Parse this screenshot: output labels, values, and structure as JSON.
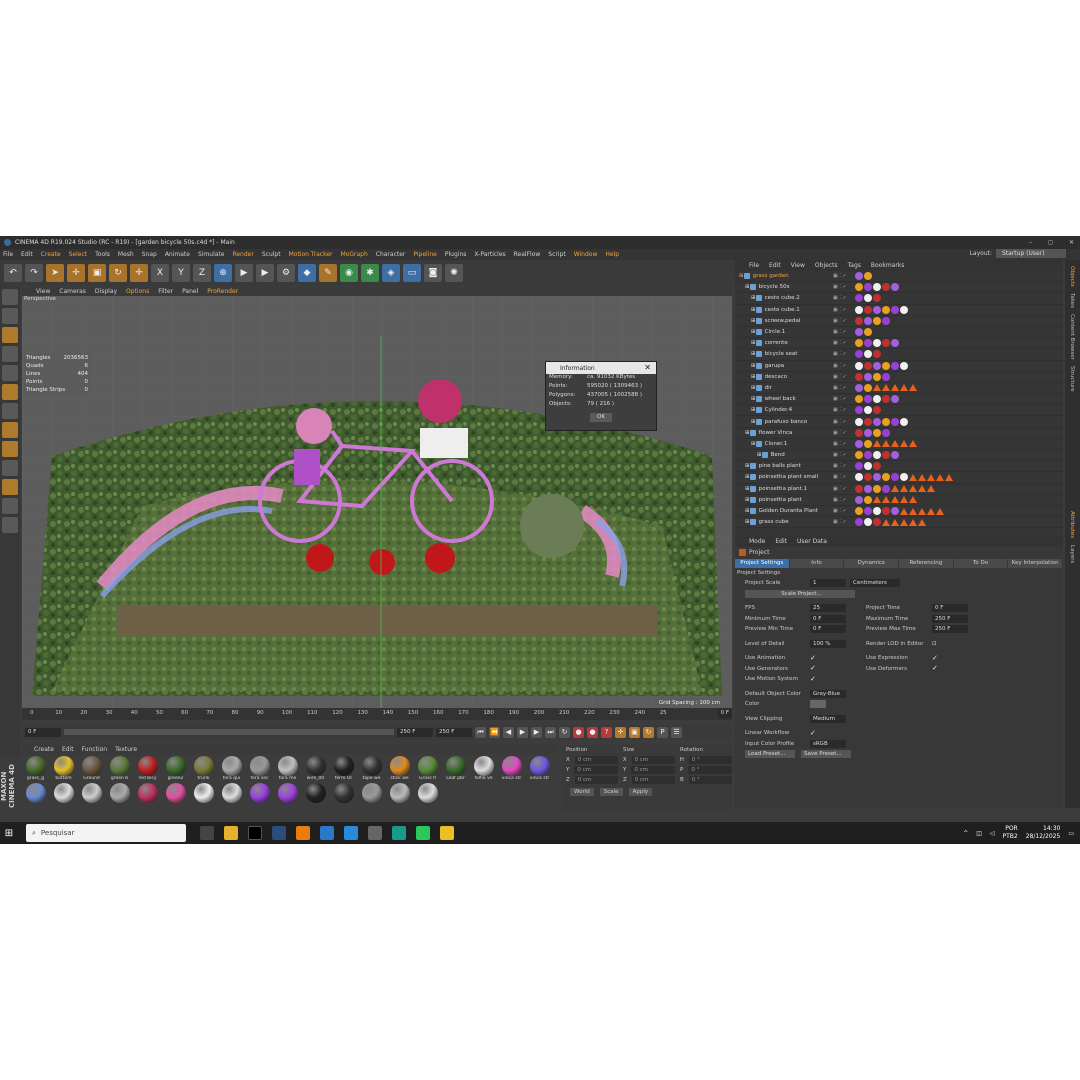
{
  "window": {
    "title": "CINEMA 4D R19.024 Studio (RC - R19) - [garden bicycle 50s.c4d *] - Main",
    "ctrl": [
      "–",
      "◻",
      "✕"
    ]
  },
  "menu": [
    "File",
    "Edit",
    "Create",
    "Select",
    "Tools",
    "Mesh",
    "Snap",
    "Animate",
    "Simulate",
    "Render",
    "Sculpt",
    "Motion Tracker",
    "MoGraph",
    "Character",
    "Pipeline",
    "Plugins",
    "X-Particles",
    "RealFlow",
    "Script",
    "Window",
    "Help"
  ],
  "menu_highlight": [
    "Create",
    "Select",
    "Render",
    "Motion Tracker",
    "MoGraph",
    "Pipeline",
    "Window",
    "Help"
  ],
  "layout": {
    "label": "Layout:",
    "value": "Startup (User)"
  },
  "viewport": {
    "menu": [
      "View",
      "Cameras",
      "Display",
      "Options",
      "Filter",
      "Panel",
      "ProRender"
    ],
    "label": "Perspective",
    "grid": "Grid Spacing : 100 cm"
  },
  "stats": [
    [
      "Triangles",
      "2036563"
    ],
    [
      "Quads",
      "6"
    ],
    [
      "Lines",
      "404"
    ],
    [
      "Points",
      "0"
    ],
    [
      "Triangle Strips",
      "0"
    ]
  ],
  "info_dialog": {
    "title": "Information",
    "rows": [
      [
        "Memory:",
        "ca. 91032 KBytes"
      ],
      [
        "Points:",
        "595020 ( 1309463 )"
      ],
      [
        "Polygons:",
        "437005 ( 1002588 )"
      ],
      [
        "Objects:",
        "79 ( 216 )"
      ]
    ],
    "ok": "OK"
  },
  "timeline": {
    "ticks": [
      "0",
      "10",
      "20",
      "30",
      "40",
      "50",
      "60",
      "70",
      "80",
      "90",
      "100",
      "110",
      "120",
      "130",
      "140",
      "150",
      "160",
      "170",
      "180",
      "190",
      "200",
      "210",
      "220",
      "230",
      "240",
      "25"
    ],
    "cur": "0 F",
    "start": "0 F",
    "end": "250 F",
    "end2": "250 F"
  },
  "materials": {
    "menu": [
      "Create",
      "Edit",
      "Function",
      "Texture"
    ],
    "items": [
      {
        "n": "grass_g",
        "c": "#4a6a2c"
      },
      {
        "n": "bottom",
        "c": "#e4c02a"
      },
      {
        "n": "Ground",
        "c": "#6a5a40"
      },
      {
        "n": "green b",
        "c": "#5a7a3a"
      },
      {
        "n": "red bicy",
        "c": "#c02020"
      },
      {
        "n": "green2",
        "c": "#3a6a2a"
      },
      {
        "n": "trunk",
        "c": "#7a7a3a"
      },
      {
        "n": "fora qui",
        "c": "#aaa"
      },
      {
        "n": "fora sec",
        "c": "#999"
      },
      {
        "n": "fora me",
        "c": "#c0c0c0"
      },
      {
        "n": "wire_00",
        "c": "#333"
      },
      {
        "n": "ferro Or",
        "c": "#222"
      },
      {
        "n": "tape we",
        "c": "#333"
      },
      {
        "n": "stick we",
        "c": "#e08a20"
      },
      {
        "n": "Grass fl",
        "c": "#5a8a3a"
      },
      {
        "n": "Leaf pbr",
        "c": "#3a6a2a"
      },
      {
        "n": "folha ve",
        "c": "#ddd"
      },
      {
        "n": "vinca str",
        "c": "#e04ac0"
      },
      {
        "n": "vinca str",
        "c": "#6a5ae0"
      },
      {
        "n": "",
        "c": "#6a8ad0"
      },
      {
        "n": "",
        "c": "#ddd"
      },
      {
        "n": "",
        "c": "#ccc"
      },
      {
        "n": "",
        "c": "#aaa"
      },
      {
        "n": "",
        "c": "#c03060"
      },
      {
        "n": "",
        "c": "#e050a0"
      },
      {
        "n": "",
        "c": "#eee"
      },
      {
        "n": "",
        "c": "#ddd"
      },
      {
        "n": "",
        "c": "#9a40e0"
      },
      {
        "n": "",
        "c": "#a040e0"
      },
      {
        "n": "",
        "c": "#222"
      },
      {
        "n": "",
        "c": "#333"
      },
      {
        "n": "",
        "c": "#999"
      },
      {
        "n": "",
        "c": "#bbb"
      },
      {
        "n": "",
        "c": "#ddd"
      }
    ]
  },
  "coords": {
    "rows": [
      [
        "X",
        "0 cm",
        "X",
        "0 cm",
        "H",
        "0 °"
      ],
      [
        "Y",
        "0 cm",
        "Y",
        "0 cm",
        "P",
        "0 °"
      ],
      [
        "Z",
        "0 cm",
        "Z",
        "0 cm",
        "B",
        "0 °"
      ]
    ],
    "world": "World",
    "scale": "Scale",
    "apply": "Apply",
    "head": [
      "Position",
      "Size",
      "Rotation"
    ]
  },
  "objects": {
    "menu": [
      "File",
      "Edit",
      "View",
      "Objects",
      "Tags",
      "Bookmarks"
    ],
    "rows": [
      {
        "n": "grass garden",
        "sel": true,
        "ind": 0
      },
      {
        "n": "bicycle 50s",
        "ind": 1
      },
      {
        "n": "cesto cube.2",
        "ind": 2
      },
      {
        "n": "cesto cube.1",
        "ind": 2
      },
      {
        "n": "screew.pedal",
        "ind": 2
      },
      {
        "n": "Circle.1",
        "ind": 2
      },
      {
        "n": "corrente",
        "ind": 2
      },
      {
        "n": "bicycle seat",
        "ind": 2
      },
      {
        "n": "garupa",
        "ind": 2
      },
      {
        "n": "descaco",
        "ind": 2
      },
      {
        "n": "dir",
        "ind": 2
      },
      {
        "n": "wheel back",
        "ind": 2
      },
      {
        "n": "Cylinder.4",
        "ind": 2
      },
      {
        "n": "parafuso banco",
        "ind": 2
      },
      {
        "n": "flower Vinca",
        "ind": 1
      },
      {
        "n": "Cloner.1",
        "ind": 2
      },
      {
        "n": "Bend",
        "ind": 3
      },
      {
        "n": "pine balls plant",
        "ind": 1
      },
      {
        "n": "poinsettia plant small",
        "ind": 1
      },
      {
        "n": "poinsettia plant.1",
        "ind": 1
      },
      {
        "n": "poinsettia plant",
        "ind": 1
      },
      {
        "n": "Golden Duranta Plant",
        "ind": 1
      },
      {
        "n": "grass cube",
        "ind": 1
      }
    ]
  },
  "attr": {
    "menu": [
      "Mode",
      "Edit",
      "User Data"
    ],
    "title": "Project",
    "tabs": [
      "Project Settings",
      "Info",
      "Dynamics",
      "Referencing",
      "To Do",
      "Key Interpolation"
    ],
    "section": "Project Settings",
    "scale_label": "Project Scale",
    "scale_val": "1",
    "scale_unit": "Centimeters",
    "scale_btn": "Scale Project...",
    "fps": [
      "FPS",
      "25"
    ],
    "ptime": [
      "Project Time",
      "0 F"
    ],
    "mint": [
      "Minimum Time",
      "0 F"
    ],
    "maxt": [
      "Maximum Time",
      "250 F"
    ],
    "pmin": [
      "Preview Min Time",
      "0 F"
    ],
    "pmax": [
      "Preview Max Time",
      "250 F"
    ],
    "lod": [
      "Level of Detail",
      "100 %"
    ],
    "rlod": "Render LOD in Editor",
    "checks": [
      "Use Animation",
      "Use Generators",
      "Use Motion System"
    ],
    "checks2": [
      "Use Expression",
      "Use Deformers"
    ],
    "doc": [
      "Default Object Color",
      "Gray-Blue"
    ],
    "color": "Color",
    "clip": [
      "View Clipping",
      "Medium"
    ],
    "lin": "Linear Workflow",
    "icp": [
      "Input Color Profile",
      "sRGB"
    ],
    "load": "Load Preset...",
    "save": "Save Preset..."
  },
  "rtabs": [
    "Objects",
    "Takes",
    "Content Browser",
    "Structure"
  ],
  "rtabs2": [
    "Attributes",
    "Layers"
  ],
  "taskbar": {
    "search": "Pesquisar",
    "lang1": "POR",
    "lang2": "PTB2",
    "time": "14:30",
    "date": "28/12/2025"
  }
}
